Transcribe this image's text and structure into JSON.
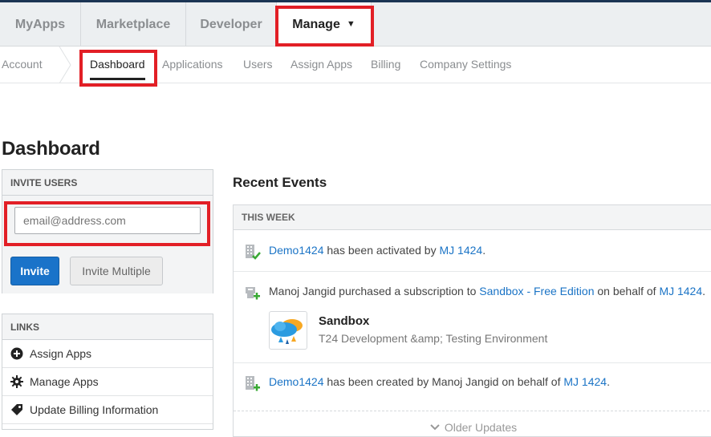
{
  "top_nav": {
    "tabs": [
      {
        "label": "MyApps"
      },
      {
        "label": "Marketplace"
      },
      {
        "label": "Developer"
      },
      {
        "label": "Manage"
      }
    ],
    "dropdown_caret": "▼"
  },
  "sub_nav": {
    "items": [
      {
        "label": "Account"
      },
      {
        "label": "Dashboard"
      },
      {
        "label": "Applications"
      },
      {
        "label": "Users"
      },
      {
        "label": "Assign Apps"
      },
      {
        "label": "Billing"
      },
      {
        "label": "Company Settings"
      }
    ],
    "active": "Dashboard"
  },
  "page": {
    "title": "Dashboard"
  },
  "invite_users": {
    "header": "INVITE USERS",
    "email_placeholder": "email@address.com",
    "invite_label": "Invite",
    "invite_multiple_label": "Invite Multiple"
  },
  "links": {
    "header": "LINKS",
    "items": [
      {
        "label": "Assign Apps",
        "icon": "plus-circle-icon"
      },
      {
        "label": "Manage Apps",
        "icon": "gear-icon"
      },
      {
        "label": "Update Billing Information",
        "icon": "tag-icon"
      }
    ]
  },
  "recent_events": {
    "title": "Recent Events",
    "section": "THIS WEEK",
    "events": [
      {
        "icon": "building-check-icon",
        "link1": "Demo1424",
        "text1": " has been activated by ",
        "link2": "MJ 1424",
        "text2": "."
      },
      {
        "icon": "register-plus-icon",
        "text0": "Manoj Jangid purchased a subscription to ",
        "link1": "Sandbox - Free Edition",
        "text1": " on behalf of ",
        "link2": "MJ 1424",
        "text2": "."
      },
      {
        "icon": "building-plus-icon",
        "link1": "Demo1424",
        "text1": " has been created by Manoj Jangid on behalf of ",
        "link2": "MJ 1424",
        "text2": "."
      }
    ],
    "app_card": {
      "name": "Sandbox",
      "description": "T24 Development &amp; Testing Environment",
      "icon": "cloud-logo-icon"
    },
    "older_label": "Older Updates"
  },
  "colors": {
    "accent": "#1a73c9",
    "highlight": "#e21f26",
    "link": "#1b74c6",
    "success": "#3aa935"
  }
}
